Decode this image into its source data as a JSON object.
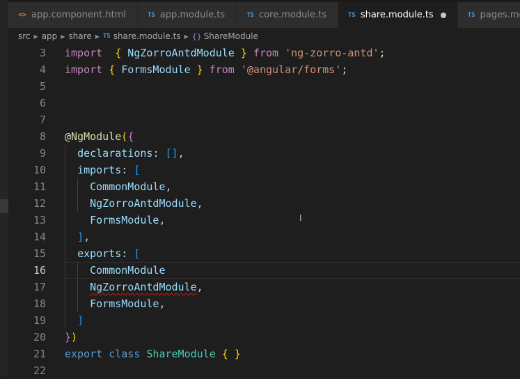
{
  "tabs": [
    {
      "icon": "<>",
      "label": "app.component.html",
      "active": false,
      "dirty": false
    },
    {
      "icon": "TS",
      "label": "app.module.ts",
      "active": false,
      "dirty": false
    },
    {
      "icon": "TS",
      "label": "core.module.ts",
      "active": false,
      "dirty": false
    },
    {
      "icon": "TS",
      "label": "share.module.ts",
      "active": true,
      "dirty": true
    },
    {
      "icon": "TS",
      "label": "pages.module.ts",
      "active": false,
      "dirty": false
    }
  ],
  "breadcrumb": {
    "parts": [
      "src",
      "app",
      "share"
    ],
    "file_icon": "TS",
    "file": "share.module.ts",
    "symbol_icon": "{}",
    "symbol": "ShareModule"
  },
  "editor": {
    "current_line": "16",
    "lines": [
      {
        "num": "3",
        "tokens": [
          [
            "kw",
            "import"
          ],
          [
            "",
            "  "
          ],
          [
            "br",
            "{"
          ],
          [
            "",
            ""
          ],
          [
            "id",
            " NgZorroAntdModule "
          ],
          [
            "br",
            "}"
          ],
          [
            "kw",
            " from "
          ],
          [
            "str",
            "'ng-zorro-antd'"
          ],
          [
            "",
            ";"
          ]
        ]
      },
      {
        "num": "4",
        "tokens": [
          [
            "kw",
            "import"
          ],
          [
            "",
            " "
          ],
          [
            "br",
            "{"
          ],
          [
            "id",
            " FormsModule "
          ],
          [
            "br",
            "}"
          ],
          [
            "kw",
            " from "
          ],
          [
            "str",
            "'@angular/forms'"
          ],
          [
            "",
            ";"
          ]
        ]
      },
      {
        "num": "5",
        "tokens": []
      },
      {
        "num": "6",
        "tokens": []
      },
      {
        "num": "7",
        "tokens": []
      },
      {
        "num": "8",
        "tokens": [
          [
            "dec",
            "@NgModule"
          ],
          [
            "br",
            "("
          ],
          [
            "br2",
            "{"
          ]
        ]
      },
      {
        "num": "9",
        "tokens": [
          [
            "",
            "  "
          ],
          [
            "id",
            "declarations"
          ],
          [
            "",
            ": "
          ],
          [
            "br3",
            "[]"
          ],
          [
            "",
            ","
          ]
        ]
      },
      {
        "num": "10",
        "tokens": [
          [
            "",
            "  "
          ],
          [
            "id",
            "imports"
          ],
          [
            "",
            ": "
          ],
          [
            "br3",
            "["
          ]
        ]
      },
      {
        "num": "11",
        "tokens": [
          [
            "",
            "    "
          ],
          [
            "id",
            "CommonModule"
          ],
          [
            "",
            ","
          ]
        ]
      },
      {
        "num": "12",
        "tokens": [
          [
            "",
            "    "
          ],
          [
            "id",
            "NgZorroAntdModule"
          ],
          [
            "",
            ","
          ]
        ]
      },
      {
        "num": "13",
        "tokens": [
          [
            "",
            "    "
          ],
          [
            "id",
            "FormsModule"
          ],
          [
            "",
            ","
          ]
        ]
      },
      {
        "num": "14",
        "tokens": [
          [
            "",
            "  "
          ],
          [
            "br3",
            "]"
          ],
          [
            "",
            ","
          ]
        ]
      },
      {
        "num": "15",
        "tokens": [
          [
            "",
            "  "
          ],
          [
            "id",
            "exports"
          ],
          [
            "",
            ": "
          ],
          [
            "br3",
            "["
          ]
        ]
      },
      {
        "num": "16",
        "tokens": [
          [
            "",
            "    "
          ],
          [
            "id",
            "CommonModule"
          ]
        ]
      },
      {
        "num": "17",
        "tokens": [
          [
            "",
            "    "
          ],
          [
            "id squig",
            "NgZorroAntdModule"
          ],
          [
            "",
            ","
          ]
        ]
      },
      {
        "num": "18",
        "tokens": [
          [
            "",
            "    "
          ],
          [
            "id",
            "FormsModule"
          ],
          [
            "",
            ","
          ]
        ]
      },
      {
        "num": "19",
        "tokens": [
          [
            "",
            "  "
          ],
          [
            "br3",
            "]"
          ]
        ]
      },
      {
        "num": "20",
        "tokens": [
          [
            "br2",
            "}"
          ],
          [
            "br",
            ")"
          ]
        ]
      },
      {
        "num": "21",
        "tokens": [
          [
            "kw2",
            "export"
          ],
          [
            "",
            " "
          ],
          [
            "kw2",
            "class"
          ],
          [
            "",
            " "
          ],
          [
            "cls",
            "ShareModule"
          ],
          [
            "",
            " "
          ],
          [
            "br",
            "{"
          ],
          [
            "",
            " "
          ],
          [
            "br",
            "}"
          ]
        ]
      },
      {
        "num": "22",
        "tokens": []
      }
    ]
  },
  "icons": {
    "html_file": "angle-brackets-icon",
    "ts_file": "typescript-icon",
    "dirty": "unsaved-dot-icon",
    "separator": "chevron-right-icon",
    "symbol": "symbol-class-icon",
    "mouse": "text-cursor-icon"
  }
}
